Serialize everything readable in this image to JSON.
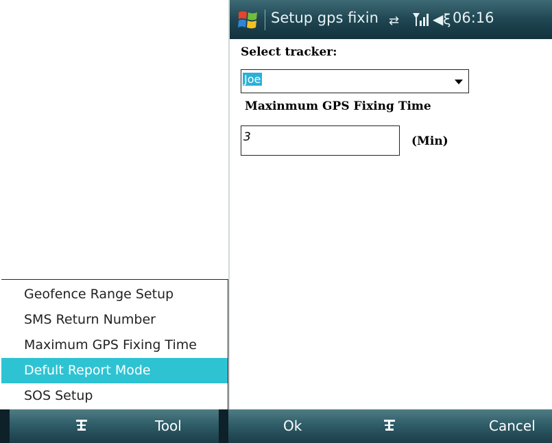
{
  "left_menu": {
    "items": [
      {
        "label": "Geofence Range Setup"
      },
      {
        "label": "SMS Return Number"
      },
      {
        "label": "Maximum GPS Fixing Time"
      },
      {
        "label": "Defult Report Mode",
        "selected": true
      },
      {
        "label": "SOS Setup"
      }
    ]
  },
  "left_softbar": {
    "center_icon": "keyboard-icon",
    "right_label": "Tool"
  },
  "titlebar": {
    "title": "Setup gps fixin",
    "time": "06:16",
    "icons": [
      "windows-start-icon",
      "connectivity-icon",
      "signal-icon",
      "volume-icon"
    ]
  },
  "form": {
    "tracker_label": "Select tracker:",
    "tracker_value": "Joe",
    "max_time_label": "Maxinmum GPS Fixing Time",
    "max_time_value": "3",
    "unit_label": "(Min)"
  },
  "right_softbar": {
    "left_label": "Ok",
    "center_icon": "keyboard-icon",
    "right_label": "Cancel"
  },
  "colors": {
    "selection": "#2ec3d3",
    "titlebar": "#1f4652",
    "softbar": "#2f5d68"
  }
}
